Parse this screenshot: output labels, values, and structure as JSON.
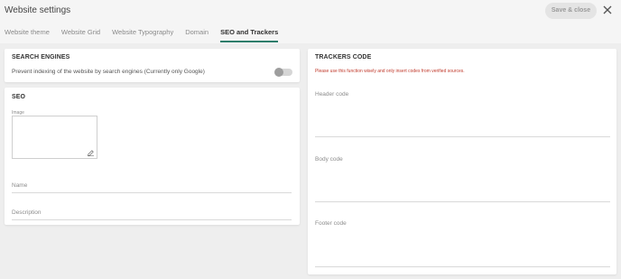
{
  "header": {
    "title": "Website settings",
    "save_label": "Save & close",
    "close_icon": "close-icon"
  },
  "tabs": [
    {
      "label": "Website theme",
      "active": false
    },
    {
      "label": "Website Grid",
      "active": false
    },
    {
      "label": "Website Typography",
      "active": false
    },
    {
      "label": "Domain",
      "active": false
    },
    {
      "label": "SEO and Trackers",
      "active": true
    }
  ],
  "search_engines": {
    "heading": "SEARCH ENGINES",
    "prevent_label": "Prevent indexing of the website by search engines (Currently only Google)",
    "toggle_on": false
  },
  "seo": {
    "heading": "SEO",
    "image_label": "Image",
    "name_label": "Name",
    "description_label": "Description"
  },
  "trackers": {
    "heading": "TRACKERS CODE",
    "warning": "Please use this function wisely and only insert codes from verified sources.",
    "header_label": "Header code",
    "body_label": "Body code",
    "footer_label": "Footer code"
  },
  "colors": {
    "accent": "#2e7d6b",
    "warning": "#c0392b"
  }
}
